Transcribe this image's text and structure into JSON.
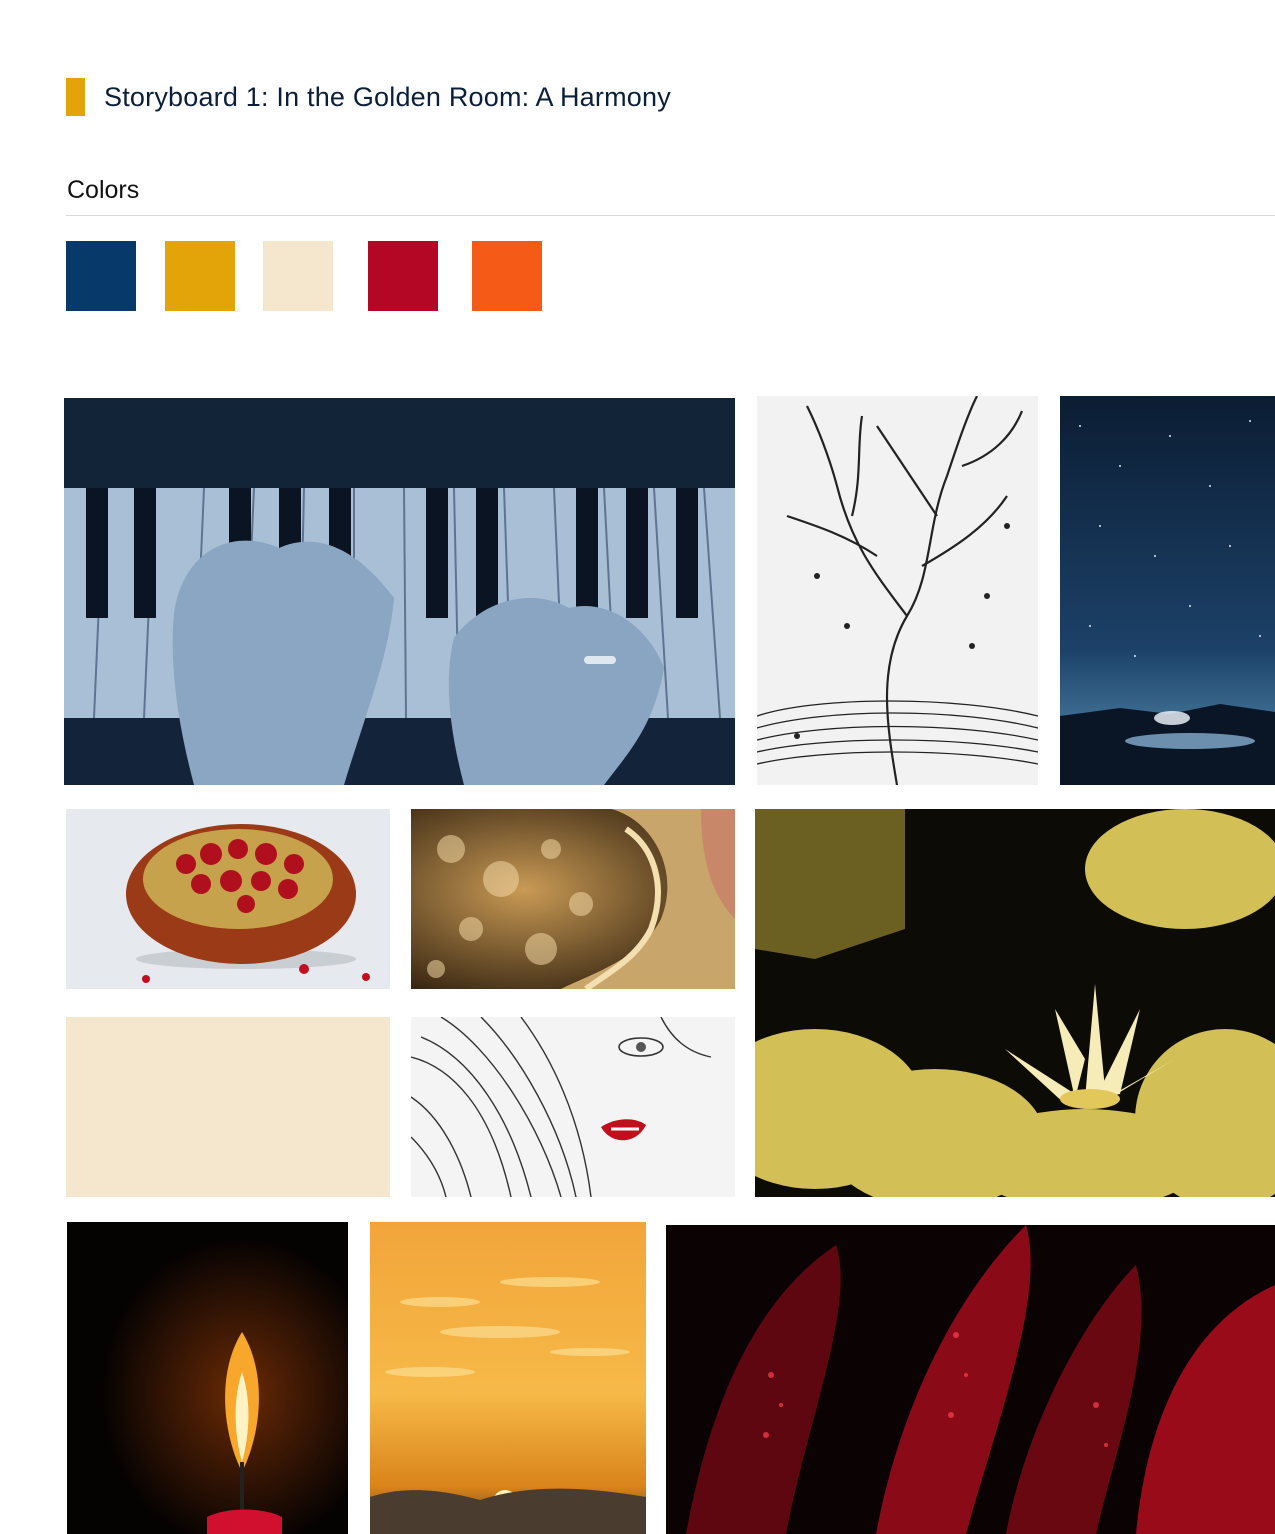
{
  "storyboard": {
    "title": "Storyboard 1: In the Golden Room: A Harmony",
    "accent_color": "#e3a40a"
  },
  "colors": {
    "label": "Colors",
    "swatches": [
      "#073a6b",
      "#e3a40a",
      "#f5e6ce",
      "#b40725",
      "#f55a17"
    ]
  },
  "mood_images": [
    "piano-hands",
    "music-tree-drawing",
    "starry-night-lake",
    "pomegranate",
    "golden-hair-bokeh",
    "water-lily-gold",
    "cream-color-block",
    "face-sketch-red-lips",
    "candle-flame",
    "orange-sunset-sky",
    "red-rose-dewdrops"
  ]
}
